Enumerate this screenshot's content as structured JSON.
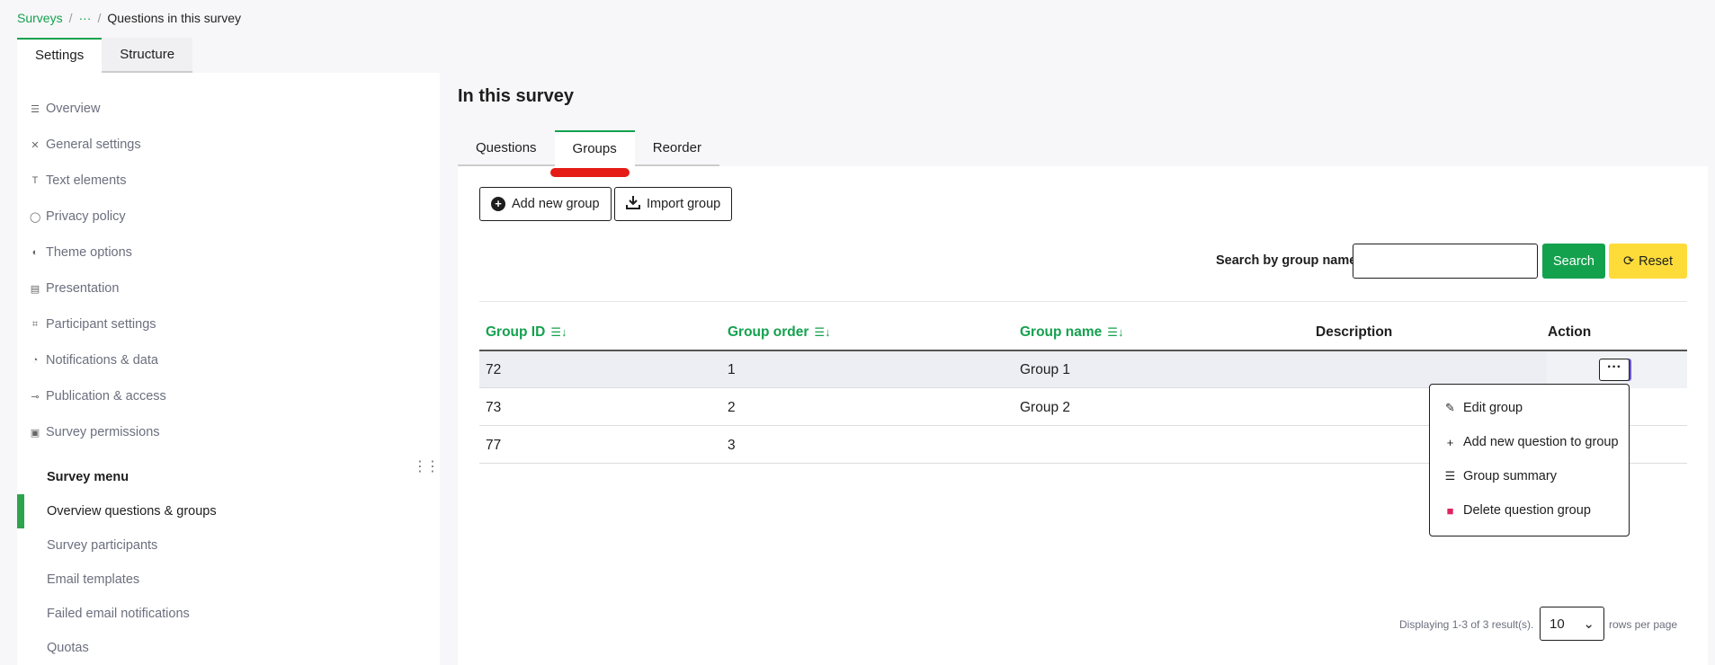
{
  "breadcrumb": {
    "root": "Surveys",
    "separator": "/",
    "ellipsis": "···",
    "current": "Questions in this survey"
  },
  "top_tabs": [
    {
      "label": "Settings",
      "active": true
    },
    {
      "label": "Structure",
      "active": false
    }
  ],
  "sidebar": {
    "settings_items": [
      {
        "icon": "overview-icon",
        "glyph": "☰",
        "label": "Overview"
      },
      {
        "icon": "tools-icon",
        "glyph": "✕",
        "label": "General settings"
      },
      {
        "icon": "text-icon",
        "glyph": "T",
        "label": "Text elements"
      },
      {
        "icon": "shield-icon",
        "glyph": "◯",
        "label": "Privacy policy"
      },
      {
        "icon": "contrast-icon",
        "glyph": "◐",
        "label": "Theme options"
      },
      {
        "icon": "presentation-icon",
        "glyph": "▤",
        "label": "Presentation"
      },
      {
        "icon": "participant-icon",
        "glyph": "⌗",
        "label": "Participant settings"
      },
      {
        "icon": "bell-icon",
        "glyph": "◔",
        "label": "Notifications & data"
      },
      {
        "icon": "key-icon",
        "glyph": "⊸",
        "label": "Publication & access"
      },
      {
        "icon": "lock-icon",
        "glyph": "▣",
        "label": "Survey permissions"
      }
    ],
    "menu_heading": "Survey menu",
    "menu_items": [
      {
        "label": "Overview questions & groups",
        "active": true
      },
      {
        "label": "Survey participants",
        "active": false
      },
      {
        "label": "Email templates",
        "active": false
      },
      {
        "label": "Failed email notifications",
        "active": false
      },
      {
        "label": "Quotas",
        "active": false
      }
    ]
  },
  "main": {
    "title": "In this survey",
    "tabs": [
      {
        "label": "Questions"
      },
      {
        "label": "Groups",
        "active": true
      },
      {
        "label": "Reorder"
      }
    ],
    "buttons": {
      "add_group": "Add new group",
      "import_group": "Import group"
    },
    "search": {
      "label": "Search by group name:",
      "value": "",
      "search_button": "Search",
      "reset_button": "Reset"
    },
    "table": {
      "headers": {
        "group_id": "Group ID",
        "group_order": "Group order",
        "group_name": "Group name",
        "description": "Description",
        "action": "Action"
      },
      "rows": [
        {
          "group_id": "72",
          "group_order": "1",
          "group_name": "Group 1",
          "description": ""
        },
        {
          "group_id": "73",
          "group_order": "2",
          "group_name": "Group 2",
          "description": ""
        },
        {
          "group_id": "77",
          "group_order": "3",
          "group_name": "",
          "description": ""
        }
      ],
      "action_button": "···"
    },
    "dropdown": [
      {
        "icon": "pencil-icon",
        "glyph": "✎",
        "label": "Edit group"
      },
      {
        "icon": "plus-icon",
        "glyph": "+",
        "label": "Add new question to group"
      },
      {
        "icon": "list-icon",
        "glyph": "☰",
        "label": "Group summary"
      },
      {
        "icon": "trash-icon",
        "glyph": "🗑",
        "label": "Delete question group",
        "color": "#e0245e"
      }
    ],
    "pagination": {
      "summary": "Displaying 1-3 of 3 result(s).",
      "page_size": "10",
      "suffix": "rows per page"
    }
  },
  "colors": {
    "accent_green": "#14a14e",
    "reset_yellow": "#fddc3a",
    "delete_red": "#e0245e",
    "annotation_red": "#e41b17"
  }
}
